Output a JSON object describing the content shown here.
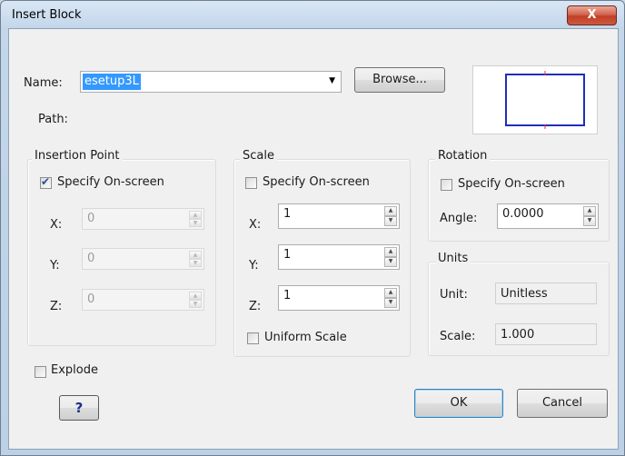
{
  "window": {
    "title": "Insert Block",
    "close_glyph": "X"
  },
  "name": {
    "label": "Name:",
    "value": "esetup3L",
    "dropdown_glyph": "▼",
    "browse_label": "Browse..."
  },
  "path": {
    "label": "Path:"
  },
  "insertion": {
    "title": "Insertion Point",
    "specify_label": "Specify On-screen",
    "specify_checked": true,
    "x": {
      "label": "X:",
      "value": "0"
    },
    "y": {
      "label": "Y:",
      "value": "0"
    },
    "z": {
      "label": "Z:",
      "value": "0"
    }
  },
  "scale": {
    "title": "Scale",
    "specify_label": "Specify On-screen",
    "specify_checked": false,
    "x": {
      "label": "X:",
      "value": "1"
    },
    "y": {
      "label": "Y:",
      "value": "1"
    },
    "z": {
      "label": "Z:",
      "value": "1"
    },
    "uniform_label": "Uniform Scale",
    "uniform_checked": false
  },
  "rotation": {
    "title": "Rotation",
    "specify_label": "Specify On-screen",
    "specify_checked": false,
    "angle_label": "Angle:",
    "angle_value": "0.0000"
  },
  "units": {
    "title": "Units",
    "unit_label": "Unit:",
    "unit_value": "Unitless",
    "scale_label": "Scale:",
    "scale_value": "1.000"
  },
  "explode": {
    "label": "Explode",
    "checked": false
  },
  "buttons": {
    "help_label": "?",
    "ok_label": "OK",
    "cancel_label": "Cancel"
  },
  "colors": {
    "preview_border": "#1f2fb8",
    "preview_marker": "#e03030",
    "selection": "#3399ff",
    "close_button": "#c13f26"
  },
  "icons": {
    "check": "checkmark-icon",
    "spin_up": "spin-up-arrow-icon",
    "spin_down": "spin-down-arrow-icon",
    "dropdown": "chevron-down-icon"
  }
}
